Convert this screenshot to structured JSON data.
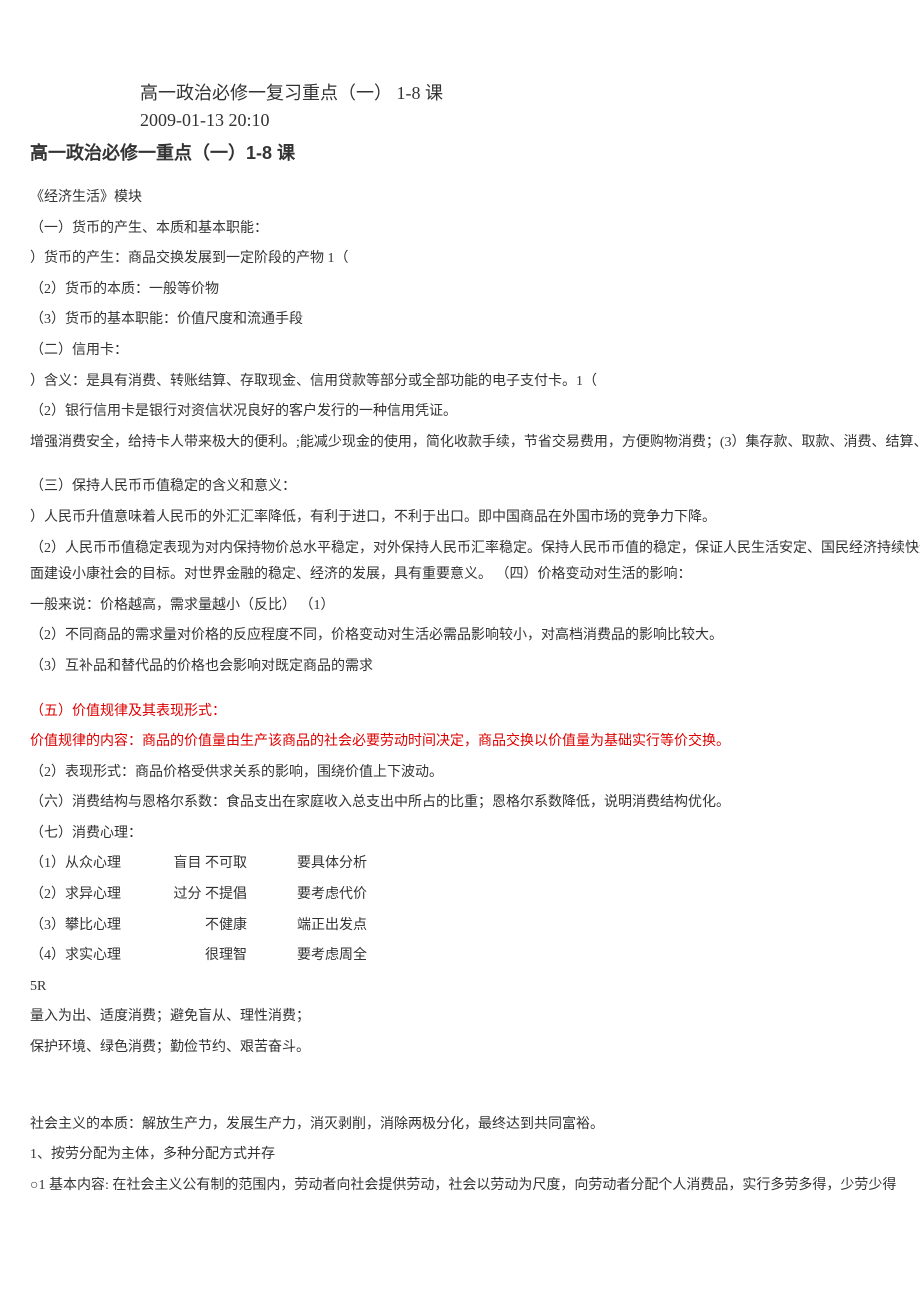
{
  "header": {
    "title_line": "高一政治必修一复习重点（一） 1-8 课",
    "timestamp": "2009-01-13 20:10",
    "bold_title": "高一政治必修一重点（一）1-8 课"
  },
  "sections": {
    "module_name": "《经济生活》模块",
    "s1_title": "（一）货币的产生、本质和基本职能：",
    "s1_1": "）货币的产生：商品交换发展到一定阶段的产物 1（",
    "s1_2": "（2）货币的本质：一般等价物",
    "s1_3": "（3）货币的基本职能：价值尺度和流通手段",
    "s2_title": "（二）信用卡：",
    "s2_1": "）含义：是具有消费、转账结算、存取现金、信用贷款等部分或全部功能的电子支付卡。1（",
    "s2_2": "（2）银行信用卡是银行对资信状况良好的客户发行的一种信用凭证。",
    "s2_3": "增强消费安全，给持卡人带来极大的便利。;能减少现金的使用，简化收款手续，节省交易费用，方便购物消费；(3）集存款、取款、消费、结算、查询为一体",
    "s3_title": "（三）保持人民币币值稳定的含义和意义：",
    "s3_1": "）人民币升值意味着人民币的外汇汇率降低，有利于进口，不利于出口。即中国商品在外国市场的竞争力下降。",
    "s3_2": "（2）人民币币值稳定表现为对内保持物价总水平稳定，对外保持人民币汇率稳定。保持人民币币值的稳定，保证人民生活安定、国民经济持续快速健康发展，能扩大就业，平衡国际收支，实现全面建设小康社会的目标。对世界金融的稳定、经济的发展，具有重要意义。 （四）价格变动对生活的影响：",
    "s3_3": "一般来说：价格越高，需求量越小（反比） （1）",
    "s3_4": "（2）不同商品的需求量对价格的反应程度不同，价格变动对生活必需品影响较小，对高档消费品的影响比较大。",
    "s3_5": "（3）互补品和替代品的价格也会影响对既定商品的需求",
    "s5_title": "（五）价值规律及其表现形式：",
    "s5_1": "价值规律的内容：商品的价值量由生产该商品的社会必要劳动时间决定，商品交换以价值量为基础实行等价交换。",
    "s5_2": "（2）表现形式：商品价格受供求关系的影响，围绕价值上下波动。",
    "s6": "（六）消费结构与恩格尔系数：食品支出在家庭收入总支出中所占的比重；恩格尔系数降低，说明消费结构优化。",
    "s7_title": "（七）消费心理：",
    "table": [
      {
        "c1": "（1）从众心理",
        "c2": "盲目 不可取",
        "c3": "要具体分析"
      },
      {
        "c1": "（2）求异心理",
        "c2": "过分 不提倡",
        "c3": "要考虑代价"
      },
      {
        "c1": "（3）攀比心理",
        "c2": "　　 不健康",
        "c3": "端正出发点"
      },
      {
        "c1": "（4）求实心理",
        "c2": "　　 很理智",
        "c3": "要考虑周全"
      }
    ],
    "r5": "5R",
    "r5_1": "量入为出、适度消费；避免盲从、理性消费；",
    "r5_2": "保护环境、绿色消费；勤俭节约、艰苦奋斗。",
    "socialism": "社会主义的本质：解放生产力，发展生产力，消灭剥削，消除两极分化，最终达到共同富裕。",
    "dist_1": "1、按劳分配为主体，多种分配方式并存",
    "dist_2": "○1 基本内容: 在社会主义公有制的范围内，劳动者向社会提供劳动，社会以劳动为尺度，向劳动者分配个人消费品，实行多劳多得，少劳少得"
  }
}
